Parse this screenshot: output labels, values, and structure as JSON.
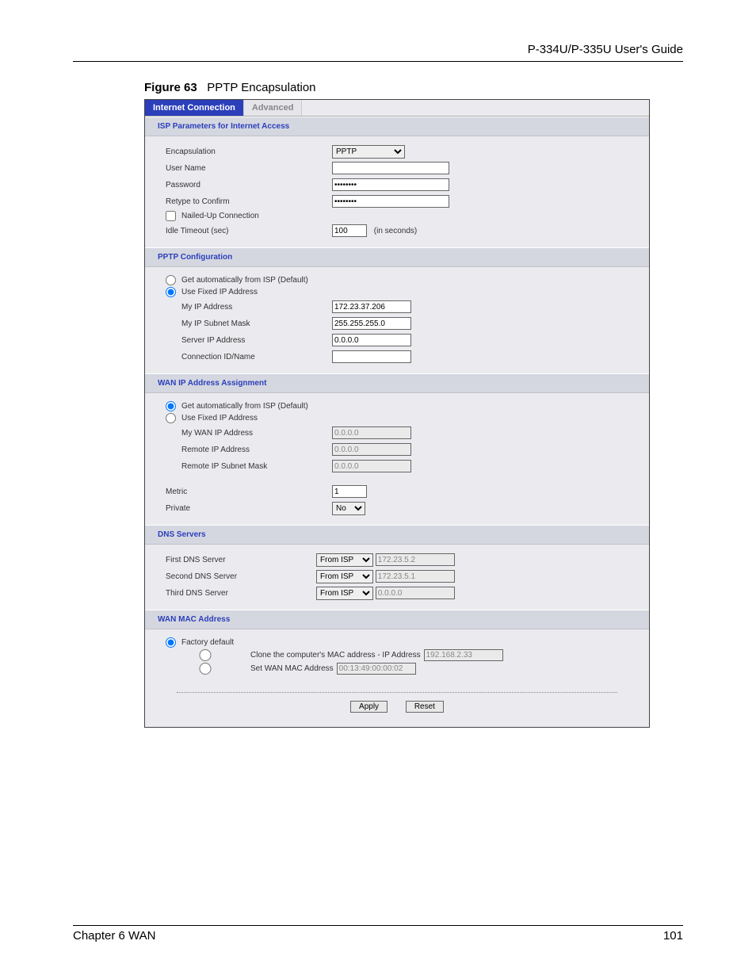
{
  "header": {
    "guide_title": "P-334U/P-335U User's Guide"
  },
  "figure": {
    "label": "Figure 63",
    "title": "PPTP Encapsulation"
  },
  "tabs": {
    "active": "Internet Connection",
    "inactive": "Advanced"
  },
  "sections": {
    "isp": {
      "title": "ISP Parameters for Internet Access",
      "encapsulation_label": "Encapsulation",
      "encapsulation_value": "PPTP",
      "username_label": "User Name",
      "username_value": "",
      "password_label": "Password",
      "password_value": "********",
      "retype_label": "Retype to Confirm",
      "retype_value": "********",
      "nailed_label": "Nailed-Up Connection",
      "idle_label": "Idle Timeout (sec)",
      "idle_value": "100",
      "idle_suffix": "(in seconds)"
    },
    "pptp": {
      "title": "PPTP Configuration",
      "radio_auto": "Get automatically from ISP (Default)",
      "radio_fixed": "Use Fixed IP Address",
      "my_ip_label": "My IP Address",
      "my_ip_value": "172.23.37.206",
      "subnet_label": "My IP Subnet Mask",
      "subnet_value": "255.255.255.0",
      "server_label": "Server IP Address",
      "server_value": "0.0.0.0",
      "conn_label": "Connection ID/Name",
      "conn_value": ""
    },
    "wan": {
      "title": "WAN IP Address Assignment",
      "radio_auto": "Get automatically from ISP (Default)",
      "radio_fixed": "Use Fixed IP Address",
      "mywan_label": "My WAN IP Address",
      "mywan_value": "0.0.0.0",
      "remip_label": "Remote IP Address",
      "remip_value": "0.0.0.0",
      "remsub_label": "Remote IP Subnet Mask",
      "remsub_value": "0.0.0.0",
      "metric_label": "Metric",
      "metric_value": "1",
      "private_label": "Private",
      "private_value": "No"
    },
    "dns": {
      "title": "DNS Servers",
      "first_label": "First DNS Server",
      "second_label": "Second DNS Server",
      "third_label": "Third DNS Server",
      "from_isp": "From ISP",
      "first_ip": "172.23.5.2",
      "second_ip": "172.23.5.1",
      "third_ip": "0.0.0.0"
    },
    "mac": {
      "title": "WAN MAC Address",
      "factory": "Factory default",
      "clone_prefix": "Clone the computer's MAC address - IP Address",
      "clone_ip": "192.168.2.33",
      "set_prefix": "Set WAN MAC Address",
      "set_value": "00:13:49:00:00:02"
    }
  },
  "buttons": {
    "apply": "Apply",
    "reset": "Reset"
  },
  "footer": {
    "chapter": "Chapter 6 WAN",
    "page": "101"
  }
}
